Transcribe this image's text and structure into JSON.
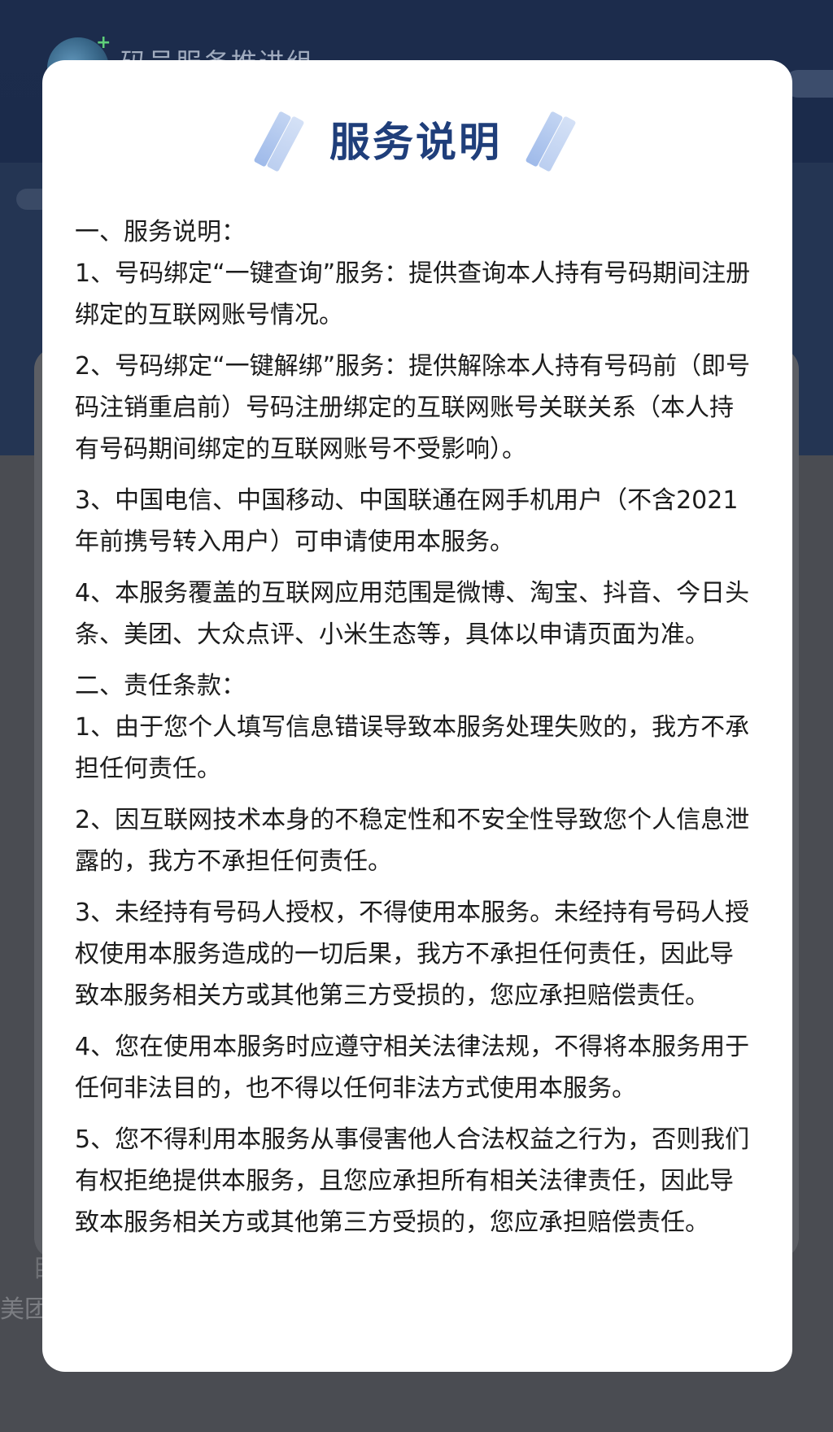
{
  "background": {
    "app_title": "码号服务推进组",
    "bottom_text_1": "美团",
    "bottom_text_2": "目"
  },
  "modal": {
    "title": "服务说明",
    "sections": [
      {
        "heading": "一、服务说明：",
        "items": [
          "1、号码绑定“一键查询”服务：提供查询本人持有号码期间注册绑定的互联网账号情况。",
          "2、号码绑定“一键解绑”服务：提供解除本人持有号码前（即号码注销重启前）号码注册绑定的互联网账号关联关系（本人持有号码期间绑定的互联网账号不受影响）。",
          "3、中国电信、中国移动、中国联通在网手机用户（不含2021年前携号转入用户）可申请使用本服务。",
          "4、本服务覆盖的互联网应用范围是微博、淘宝、抖音、今日头条、美团、大众点评、小米生态等，具体以申请页面为准。"
        ]
      },
      {
        "heading": "二、责任条款：",
        "items": [
          "1、由于您个人填写信息错误导致本服务处理失败的，我方不承担任何责任。",
          "2、因互联网技术本身的不稳定性和不安全性导致您个人信息泄露的，我方不承担任何责任。",
          "3、未经持有号码人授权，不得使用本服务。未经持有号码人授权使用本服务造成的一切后果，我方不承担任何责任，因此导致本服务相关方或其他第三方受损的，您应承担赔偿责任。",
          "4、您在使用本服务时应遵守相关法律法规，不得将本服务用于任何非法目的，也不得以任何非法方式使用本服务。",
          "5、您不得利用本服务从事侵害他人合法权益之行为，否则我们有权拒绝提供本服务，且您应承担所有相关法律责任，因此导致本服务相关方或其他第三方受损的，您应承担赔偿责任。"
        ]
      }
    ]
  },
  "colors": {
    "title": "#1f3e7a",
    "overlay": "#4a4c52",
    "header_bg": "#1c2c4c"
  }
}
